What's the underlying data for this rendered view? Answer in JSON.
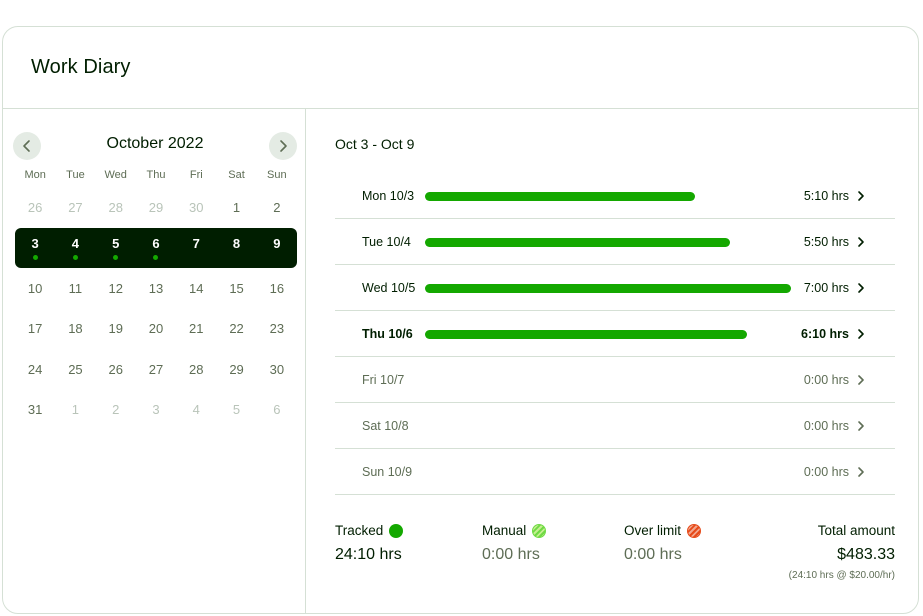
{
  "header": {
    "title": "Work Diary"
  },
  "calendar": {
    "month_label": "October 2022",
    "prev_icon": "chevron-left-icon",
    "next_icon": "chevron-right-icon",
    "weekdays": [
      "Mon",
      "Tue",
      "Wed",
      "Thu",
      "Fri",
      "Sat",
      "Sun"
    ],
    "weeks": [
      {
        "selected": false,
        "days": [
          {
            "d": "26",
            "muted": true
          },
          {
            "d": "27",
            "muted": true
          },
          {
            "d": "28",
            "muted": true
          },
          {
            "d": "29",
            "muted": true
          },
          {
            "d": "30",
            "muted": true
          },
          {
            "d": "1",
            "muted": false
          },
          {
            "d": "2",
            "muted": false
          }
        ]
      },
      {
        "selected": true,
        "days": [
          {
            "d": "3",
            "dot": true
          },
          {
            "d": "4",
            "dot": true
          },
          {
            "d": "5",
            "dot": true
          },
          {
            "d": "6",
            "dot": true
          },
          {
            "d": "7",
            "dot": false
          },
          {
            "d": "8",
            "dot": false
          },
          {
            "d": "9",
            "dot": false
          }
        ]
      },
      {
        "selected": false,
        "days": [
          {
            "d": "10"
          },
          {
            "d": "11"
          },
          {
            "d": "12"
          },
          {
            "d": "13"
          },
          {
            "d": "14"
          },
          {
            "d": "15"
          },
          {
            "d": "16"
          }
        ]
      },
      {
        "selected": false,
        "days": [
          {
            "d": "17"
          },
          {
            "d": "18"
          },
          {
            "d": "19"
          },
          {
            "d": "20"
          },
          {
            "d": "21"
          },
          {
            "d": "22"
          },
          {
            "d": "23"
          }
        ]
      },
      {
        "selected": false,
        "days": [
          {
            "d": "24"
          },
          {
            "d": "25"
          },
          {
            "d": "26"
          },
          {
            "d": "27"
          },
          {
            "d": "28"
          },
          {
            "d": "29"
          },
          {
            "d": "30"
          }
        ]
      },
      {
        "selected": false,
        "days": [
          {
            "d": "31"
          },
          {
            "d": "1",
            "muted": true
          },
          {
            "d": "2",
            "muted": true
          },
          {
            "d": "3",
            "muted": true
          },
          {
            "d": "4",
            "muted": true
          },
          {
            "d": "5",
            "muted": true
          },
          {
            "d": "6",
            "muted": true
          }
        ]
      }
    ]
  },
  "detail": {
    "range_label": "Oct 3 - Oct 9",
    "max_hours": 7.0,
    "rows": [
      {
        "label": "Mon 10/3",
        "value": "5:10 hrs",
        "hours": 5.167,
        "state": "normal"
      },
      {
        "label": "Tue 10/4",
        "value": "5:50 hrs",
        "hours": 5.833,
        "state": "normal"
      },
      {
        "label": "Wed 10/5",
        "value": "7:00 hrs",
        "hours": 7.0,
        "state": "normal"
      },
      {
        "label": "Thu 10/6",
        "value": "6:10 hrs",
        "hours": 6.167,
        "state": "active"
      },
      {
        "label": "Fri 10/7",
        "value": "0:00 hrs",
        "hours": 0,
        "state": "empty"
      },
      {
        "label": "Sat 10/8",
        "value": "0:00 hrs",
        "hours": 0,
        "state": "empty"
      },
      {
        "label": "Sun 10/9",
        "value": "0:00 hrs",
        "hours": 0,
        "state": "empty"
      }
    ]
  },
  "summary": {
    "tracked": {
      "label": "Tracked",
      "value": "24:10 hrs",
      "icon": "tracked-dot-icon",
      "color": "#14a800"
    },
    "manual": {
      "label": "Manual",
      "value": "0:00 hrs",
      "icon": "manual-striped-dot-icon",
      "color": "#6fda44"
    },
    "over_limit": {
      "label": "Over limit",
      "value": "0:00 hrs",
      "icon": "over-limit-striped-dot-icon",
      "color": "#e64a19"
    },
    "total": {
      "label": "Total amount",
      "value": "$483.33",
      "note": "(24:10 hrs @ $20.00/hr)"
    }
  },
  "colors": {
    "accent": "#14a800",
    "selected_week_bg": "#001e00",
    "border": "#d5e0d5"
  }
}
